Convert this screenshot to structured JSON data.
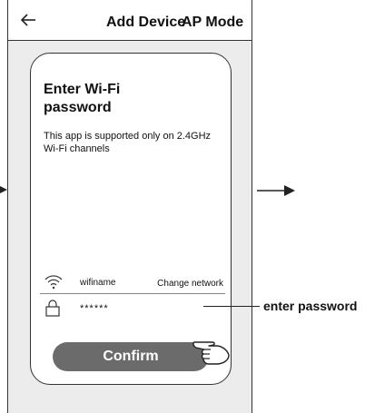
{
  "header": {
    "title": "Add Device",
    "back_icon": "arrow-left-icon"
  },
  "card": {
    "heading": "Enter Wi-Fi password",
    "note": "This app is supported only on 2.4GHz Wi-Fi channels",
    "wifi": {
      "icon": "wifi-icon",
      "name": "wifiname",
      "change_label": "Change network"
    },
    "password": {
      "icon": "lock-icon",
      "value": "******"
    },
    "confirm_label": "Confirm"
  },
  "annotations": {
    "mode_label": "AP Mode",
    "enter_password_label": "enter password"
  },
  "colors": {
    "screen_bg": "#ececec",
    "card_bg": "#ffffff",
    "button_bg": "#6b6b6b",
    "button_text": "#ffffff"
  }
}
